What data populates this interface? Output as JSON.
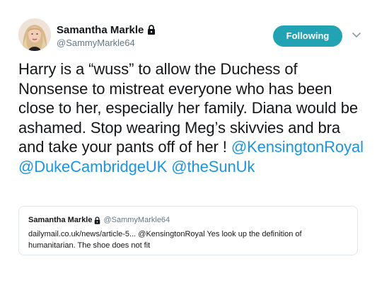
{
  "tweet": {
    "author": {
      "name": "Samantha Markle",
      "handle": "@SammyMarkle64"
    },
    "follow_button": "Following",
    "text_before": "Harry is a “wuss”  to allow the Duchess of Nonsense  to mistreat everyone who has been close to her, especially her family. Diana would be ashamed.  Stop wearing Meg’s skivvies and bra  and take your pants off of her ! ",
    "mentions": [
      "@KensingtonRoyal",
      "@DukeCambridgeUK",
      "@theSunUk"
    ]
  },
  "quoted": {
    "name": "Samantha Markle",
    "handle": "@SammyMarkle64",
    "text": "dailymail.co.uk/news/article-5... @KensingtonRoyal Yes look up the definition of humanitarian. The shoe does not fit"
  },
  "colors": {
    "accent": "#22a3b4",
    "link": "#1b95e0",
    "muted": "#657786"
  },
  "icons": {
    "lock": "lock-icon",
    "chevron": "chevron-down-icon"
  }
}
